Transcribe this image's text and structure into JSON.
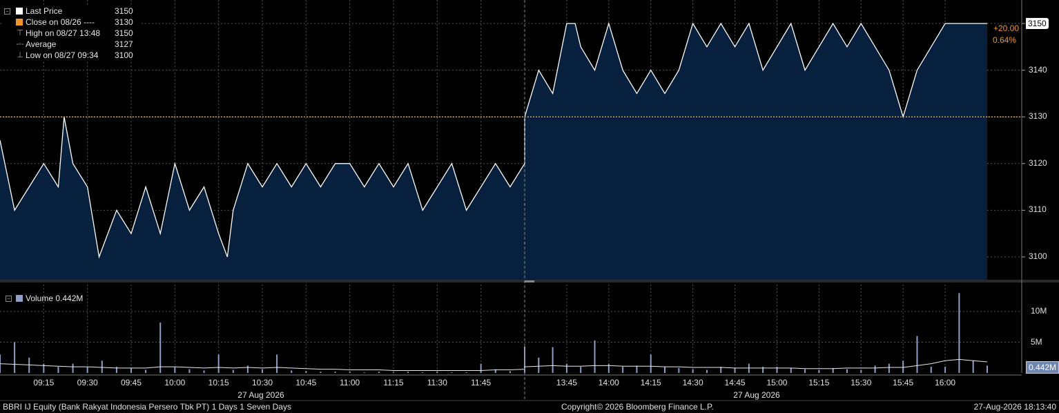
{
  "legend": {
    "items": [
      {
        "label": "Last Price",
        "value": "3150",
        "marker": "square",
        "color": "#ffffff"
      },
      {
        "label": "Close on 08/26 ----",
        "value": "3130",
        "marker": "square",
        "color": "#f0962a"
      },
      {
        "label": "High on 08/27 13:48",
        "value": "3150",
        "marker": "high-tick-icon",
        "color": "#aaaaaa"
      },
      {
        "label": "Average",
        "value": "3127",
        "marker": "average-line-icon",
        "color": "#aaaaaa"
      },
      {
        "label": "Low on 08/27 09:34",
        "value": "3100",
        "marker": "low-tick-icon",
        "color": "#aaaaaa"
      }
    ],
    "volume_label": "Volume 0.442M"
  },
  "tags": {
    "last_price": "3150",
    "change_abs": "+20.00",
    "change_pct": "0.64%",
    "last_volume": "0.442M"
  },
  "price_axis": {
    "ticks": [
      "3150",
      "3140",
      "3130",
      "3120",
      "3110",
      "3100"
    ]
  },
  "volume_axis": {
    "ticks": [
      "10M",
      "5M"
    ]
  },
  "time_axis": {
    "ticks": [
      "09:15",
      "09:30",
      "09:45",
      "10:00",
      "10:15",
      "10:30",
      "10:45",
      "11:00",
      "11:15",
      "11:30",
      "11:45",
      "13:45",
      "14:00",
      "14:15",
      "14:30",
      "14:45",
      "15:00",
      "15:15",
      "15:30",
      "15:45",
      "16:00"
    ],
    "date_labels": [
      "27 Aug 2026",
      "27 Aug 2026"
    ]
  },
  "footer": {
    "security": "BBRI IJ Equity (Bank Rakyat Indonesia Persero Tbk PT) 1 Days 1 Seven Days",
    "copyright": "Copyright© 2026 Bloomberg Finance L.P.",
    "timestamp": "27-Aug-2026 18:13:40"
  },
  "colors": {
    "price_line": "#ffffff",
    "area_fill": "#06203e",
    "prev_close": "#f0962a",
    "volume_bar": "#8f9fc8",
    "grid": "#555555",
    "tag_bg": "#ffffff",
    "vol_tag_bg": "#6f86b0"
  },
  "chart_data": [
    {
      "type": "area",
      "title": "",
      "series": [
        {
          "name": "Last Price"
        }
      ],
      "ylim": [
        3095,
        3155
      ],
      "previous_close": 3130,
      "x": [
        "09:00",
        "09:05",
        "09:10",
        "09:15",
        "09:20",
        "09:22",
        "09:25",
        "09:30",
        "09:34",
        "09:40",
        "09:45",
        "09:50",
        "09:55",
        "10:00",
        "10:05",
        "10:10",
        "10:15",
        "10:18",
        "10:20",
        "10:25",
        "10:30",
        "10:35",
        "10:40",
        "10:45",
        "10:50",
        "10:55",
        "11:00",
        "11:05",
        "11:10",
        "11:15",
        "11:20",
        "11:25",
        "11:30",
        "11:35",
        "11:40",
        "11:45",
        "11:50",
        "11:55",
        "12:00",
        "13:30",
        "13:35",
        "13:40",
        "13:45",
        "13:48",
        "13:50",
        "13:55",
        "14:00",
        "14:05",
        "14:10",
        "14:15",
        "14:20",
        "14:25",
        "14:30",
        "14:35",
        "14:40",
        "14:45",
        "14:50",
        "14:55",
        "15:00",
        "15:05",
        "15:10",
        "15:15",
        "15:20",
        "15:25",
        "15:30",
        "15:35",
        "15:40",
        "15:45",
        "15:50",
        "15:55",
        "16:00",
        "16:05",
        "16:10",
        "16:15"
      ],
      "y": [
        3125,
        3110,
        3115,
        3120,
        3115,
        3130,
        3120,
        3115,
        3100,
        3110,
        3105,
        3115,
        3105,
        3120,
        3110,
        3115,
        3105,
        3100,
        3110,
        3120,
        3115,
        3120,
        3115,
        3120,
        3115,
        3120,
        3120,
        3115,
        3120,
        3115,
        3120,
        3110,
        3115,
        3120,
        3110,
        3115,
        3120,
        3115,
        3120,
        3130,
        3140,
        3135,
        3150,
        3150,
        3145,
        3140,
        3150,
        3140,
        3135,
        3140,
        3135,
        3140,
        3150,
        3145,
        3150,
        3145,
        3150,
        3140,
        3145,
        3150,
        3140,
        3145,
        3150,
        3145,
        3150,
        3145,
        3140,
        3130,
        3140,
        3145,
        3150,
        3150,
        3150,
        3150
      ],
      "ylabel": "",
      "grid": true
    },
    {
      "type": "bar",
      "title": "",
      "series": [
        {
          "name": "Volume"
        }
      ],
      "ylim": [
        0,
        14
      ],
      "unit": "M",
      "x": [
        "09:00",
        "09:05",
        "09:10",
        "09:15",
        "09:20",
        "09:25",
        "09:30",
        "09:35",
        "09:40",
        "09:45",
        "09:50",
        "09:55",
        "10:00",
        "10:05",
        "10:10",
        "10:15",
        "10:20",
        "10:25",
        "10:30",
        "10:35",
        "10:40",
        "10:45",
        "10:50",
        "10:55",
        "11:00",
        "11:05",
        "11:10",
        "11:15",
        "11:20",
        "11:25",
        "11:30",
        "11:35",
        "11:40",
        "11:45",
        "11:50",
        "11:55",
        "12:00",
        "13:30",
        "13:35",
        "13:40",
        "13:45",
        "13:50",
        "13:55",
        "14:00",
        "14:05",
        "14:10",
        "14:15",
        "14:20",
        "14:25",
        "14:30",
        "14:35",
        "14:40",
        "14:45",
        "14:50",
        "14:55",
        "15:00",
        "15:05",
        "15:10",
        "15:15",
        "15:20",
        "15:25",
        "15:30",
        "15:35",
        "15:40",
        "15:45",
        "15:50",
        "15:55",
        "16:00",
        "16:05",
        "16:10",
        "16:15"
      ],
      "values": [
        3.0,
        5.0,
        2.5,
        1.5,
        1.0,
        1.5,
        1.0,
        2.0,
        1.0,
        0.8,
        0.5,
        8.2,
        1.0,
        0.6,
        0.4,
        3.0,
        0.5,
        1.2,
        0.6,
        3.0,
        0.4,
        0.3,
        0.2,
        0.2,
        0.2,
        0.1,
        0.2,
        0.1,
        0.2,
        0.1,
        0.2,
        0.1,
        0.1,
        1.5,
        0.6,
        0.3,
        3.5,
        4.3,
        2.5,
        4.2,
        1.5,
        1.0,
        5.3,
        1.5,
        1.0,
        1.2,
        3.0,
        1.0,
        0.8,
        0.6,
        0.5,
        1.0,
        0.8,
        1.5,
        1.0,
        1.0,
        0.8,
        0.6,
        0.5,
        0.8,
        0.6,
        0.5,
        1.2,
        1.5,
        2.0,
        6.0,
        1.0,
        1.0,
        13.0,
        2.0,
        1.2,
        0.442
      ],
      "average_line": [
        1.5,
        1.4,
        1.3,
        1.2,
        1.1,
        1.0,
        1.0,
        0.9,
        0.8,
        0.8,
        0.8,
        1.0,
        1.0,
        0.9,
        0.8,
        0.9,
        0.8,
        0.9,
        0.8,
        0.9,
        0.8,
        0.7,
        0.6,
        0.6,
        0.5,
        0.5,
        0.5,
        0.4,
        0.4,
        0.4,
        0.4,
        0.4,
        0.4,
        0.4,
        0.5,
        0.5,
        0.6,
        1.0,
        1.1,
        1.2,
        1.1,
        1.1,
        1.2,
        1.2,
        1.1,
        1.1,
        1.1,
        1.0,
        1.0,
        0.9,
        0.9,
        0.9,
        0.8,
        0.8,
        0.8,
        0.8,
        0.8,
        0.7,
        0.7,
        0.7,
        0.8,
        0.8,
        0.8,
        0.9,
        0.9,
        1.2,
        1.5,
        2.0,
        2.2,
        2.0,
        1.8,
        1.7
      ]
    }
  ]
}
